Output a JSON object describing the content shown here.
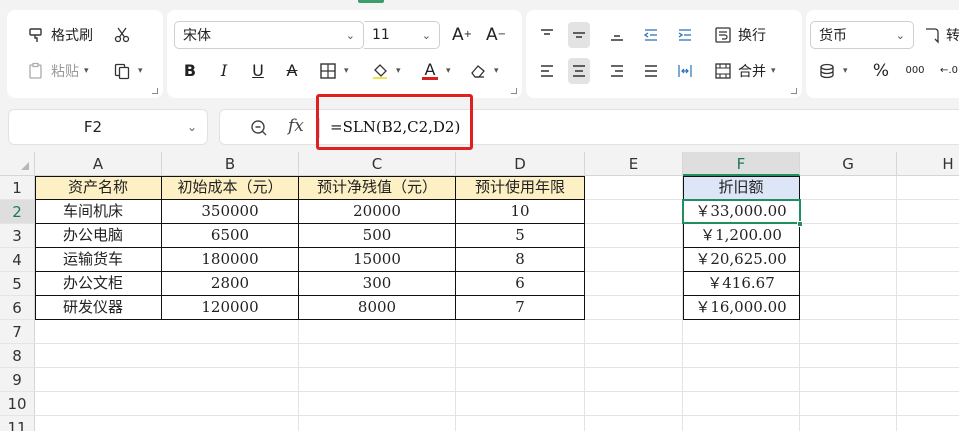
{
  "ribbon": {
    "format_painter": "格式刷",
    "paste": "粘贴",
    "font_name": "宋体",
    "font_size": "11",
    "wrap_text": "换行",
    "merge": "合并",
    "number_format": "货币",
    "convert": "转",
    "percent_symbol": "%",
    "thousands_symbol": "000"
  },
  "formula_bar": {
    "name_box": "F2",
    "fx_label": "fx",
    "formula": "=SLN(B2,C2,D2)"
  },
  "columns": [
    "A",
    "B",
    "C",
    "D",
    "E",
    "F",
    "G",
    "H"
  ],
  "rows": [
    "1",
    "2",
    "3",
    "4",
    "5",
    "6",
    "7",
    "8",
    "9",
    "10",
    "11"
  ],
  "table": {
    "headers": [
      "资产名称",
      "初始成本（元）",
      "预计净残值（元）",
      "预计使用年限"
    ],
    "rows": [
      [
        "车间机床",
        "350000",
        "20000",
        "10"
      ],
      [
        "办公电脑",
        "6500",
        "500",
        "5"
      ],
      [
        "运输货车",
        "180000",
        "15000",
        "8"
      ],
      [
        "办公文柜",
        "2800",
        "300",
        "6"
      ],
      [
        "研发仪器",
        "120000",
        "8000",
        "7"
      ]
    ]
  },
  "depreciation": {
    "header": "折旧额",
    "values": [
      "￥33,000.00",
      "￥1,200.00",
      "￥20,625.00",
      "￥416.67",
      "￥16,000.00"
    ]
  },
  "active_cell": "F2",
  "colors": {
    "header_fill": "#fdf0c5",
    "result_header_fill": "#dce6f7",
    "selection": "#1f8f5f",
    "highlight_box": "#e02020"
  }
}
